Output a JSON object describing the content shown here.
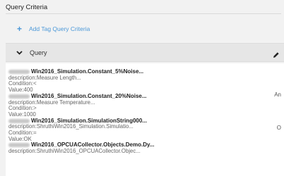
{
  "panel": {
    "title": "Query Criteria",
    "add_label": "Add Tag Query Criteria"
  },
  "section": {
    "label": "Query"
  },
  "queries": [
    {
      "name": "Win2016_Simulation.Constant_5%Noise...",
      "description": "description:Measure Length...",
      "condition": "Condition:<",
      "value": "Value:400",
      "operator": "An"
    },
    {
      "name": "Win2016_Simulation.Constant_20%Noise...",
      "description": "description:Measure Temperature...",
      "condition": "Condition:>",
      "value": "Value:1000",
      "operator": "O"
    },
    {
      "name": "Win2016_Simulation.SimulationString000...",
      "description": "description:ShruthiWin2016_Simulation.Simulatio...",
      "condition": "Condition:=",
      "value": "Value:OK"
    },
    {
      "name": "Win2016_OPCUACollector.Objects.Demo.Dy...",
      "description": "description:ShruthiWin2016_OPCUACollector.Objec..."
    }
  ],
  "icons": {
    "add": "plus-icon",
    "collapse": "chevron-down-icon",
    "edit": "pencil-icon"
  },
  "colors": {
    "accent": "#4b98d8"
  }
}
